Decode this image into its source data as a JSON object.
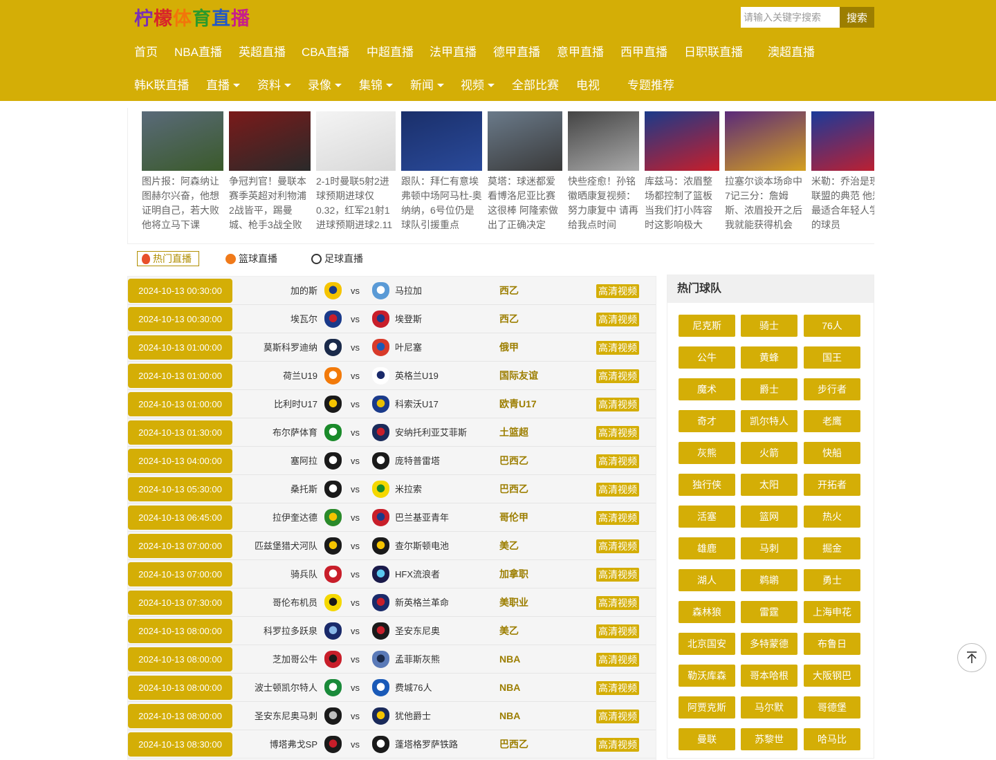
{
  "logo": {
    "chars": [
      "柠",
      "檬",
      "体",
      "育",
      "直",
      "播"
    ]
  },
  "search": {
    "placeholder": "请输入关键字搜索",
    "button": "搜索"
  },
  "nav": {
    "row1": [
      "首页",
      "NBA直播",
      "英超直播",
      "CBA直播",
      "中超直播",
      "法甲直播",
      "德甲直播",
      "意甲直播",
      "西甲直播",
      "日职联直播",
      "澳超直播"
    ],
    "row2": [
      {
        "label": "韩K联直播",
        "dropdown": false
      },
      {
        "label": "直播",
        "dropdown": true
      },
      {
        "label": "资料",
        "dropdown": true
      },
      {
        "label": "录像",
        "dropdown": true
      },
      {
        "label": "集锦",
        "dropdown": true
      },
      {
        "label": "新闻",
        "dropdown": true
      },
      {
        "label": "视频",
        "dropdown": true
      },
      {
        "label": "全部比赛",
        "dropdown": false
      },
      {
        "label": "电视",
        "dropdown": false
      },
      {
        "label": "专题推荐",
        "dropdown": false
      }
    ]
  },
  "carousel": [
    {
      "caption": "图片报：阿森纳让图赫尔兴奋，他想证明自己，若大败他将立马下课",
      "colors": [
        "#5a6a7a",
        "#3a5a2a"
      ]
    },
    {
      "caption": "争冠判官！曼联本赛季英超对利物浦2战皆平，踢曼城、枪手3战全败",
      "colors": [
        "#7a1a1a",
        "#2a2a2a"
      ]
    },
    {
      "caption": "2-1时曼联5射2进球预期进球仅0.32，红军21射1进球预期进球2.11",
      "colors": [
        "#f4f4f4",
        "#d8d8d8"
      ]
    },
    {
      "caption": "跟队：拜仁有意埃弗顿中场阿马杜-奥纳纳，6号位仍是球队引援重点",
      "colors": [
        "#1a2f6a",
        "#2a4a9a"
      ]
    },
    {
      "caption": "莫塔：球迷都爱看博洛尼亚比赛 这很棒 阿隆索做出了正确决定",
      "colors": [
        "#6a7a8a",
        "#3a3a3a"
      ]
    },
    {
      "caption": "快些痊愈！孙铭徽晒康复视频：努力康复中 请再给我点时间",
      "colors": [
        "#444444",
        "#aaaaaa"
      ]
    },
    {
      "caption": "库兹马：浓眉整场都控制了篮板 当我们打小阵容时这影响极大",
      "colors": [
        "#1a3a8a",
        "#c81e2a"
      ]
    },
    {
      "caption": "拉塞尔谈本场命中7记三分：詹姆斯、浓眉投开之后我就能获得机会",
      "colors": [
        "#5a2a7a",
        "#d4a020"
      ]
    },
    {
      "caption": "米勒：乔治是现在联盟的典范 他是最适合年轻人学习的球员",
      "colors": [
        "#1a3a9a",
        "#c81e2a"
      ]
    }
  ],
  "tabs": [
    {
      "label": "热门直播",
      "icon": "flame-icon"
    },
    {
      "label": "篮球直播",
      "icon": "basketball-icon"
    },
    {
      "label": "足球直播",
      "icon": "soccer-ball-icon"
    }
  ],
  "matches": [
    {
      "time": "2024-10-13 00:30:00",
      "home": "加的斯",
      "away": "马拉加",
      "league": "西乙",
      "video": "高清视频",
      "hc": [
        "#f5c400",
        "#1a3a8a"
      ],
      "ac": [
        "#5a9ad6",
        "#ffffff"
      ]
    },
    {
      "time": "2024-10-13 00:30:00",
      "home": "埃瓦尔",
      "away": "埃登斯",
      "league": "西乙",
      "video": "高清视频",
      "hc": [
        "#1a3a8a",
        "#c81e2a"
      ],
      "ac": [
        "#c81e2a",
        "#1a3a8a"
      ]
    },
    {
      "time": "2024-10-13 01:00:00",
      "home": "莫斯科罗迪纳",
      "away": "叶尼塞",
      "league": "俄甲",
      "video": "高清视频",
      "hc": [
        "#1a2a4a",
        "#ffffff"
      ],
      "ac": [
        "#d83a2a",
        "#1a5ab8"
      ]
    },
    {
      "time": "2024-10-13 01:00:00",
      "home": "荷兰U19",
      "away": "英格兰U19",
      "league": "国际友谊",
      "video": "高清视频",
      "hc": [
        "#f27a0a",
        "#ffffff"
      ],
      "ac": [
        "#ffffff",
        "#1a2a6a"
      ]
    },
    {
      "time": "2024-10-13 01:00:00",
      "home": "比利时U17",
      "away": "科索沃U17",
      "league": "欧青U17",
      "video": "高清视频",
      "hc": [
        "#1a1a1a",
        "#f5c400"
      ],
      "ac": [
        "#1a3a8a",
        "#e8c000"
      ]
    },
    {
      "time": "2024-10-13 01:30:00",
      "home": "布尔萨体育",
      "away": "安纳托利亚艾菲斯",
      "league": "土篮超",
      "video": "高清视频",
      "hc": [
        "#1a8a2a",
        "#ffffff"
      ],
      "ac": [
        "#1a2a5a",
        "#c81e2a"
      ]
    },
    {
      "time": "2024-10-13 04:00:00",
      "home": "塞阿拉",
      "away": "庞特普雷塔",
      "league": "巴西乙",
      "video": "高清视频",
      "hc": [
        "#1a1a1a",
        "#ffffff"
      ],
      "ac": [
        "#1a1a1a",
        "#ffffff"
      ]
    },
    {
      "time": "2024-10-13 05:30:00",
      "home": "桑托斯",
      "away": "米拉索",
      "league": "巴西乙",
      "video": "高清视频",
      "hc": [
        "#1a1a1a",
        "#ffffff"
      ],
      "ac": [
        "#f5d800",
        "#1a8a2a"
      ]
    },
    {
      "time": "2024-10-13 06:45:00",
      "home": "拉伊奎达德",
      "away": "巴兰基亚青年",
      "league": "哥伦甲",
      "video": "高清视频",
      "hc": [
        "#2a8a2a",
        "#f5c400"
      ],
      "ac": [
        "#c81e2a",
        "#1a3a8a"
      ]
    },
    {
      "time": "2024-10-13 07:00:00",
      "home": "匹兹堡猎犬河队",
      "away": "查尔斯顿电池",
      "league": "美乙",
      "video": "高清视频",
      "hc": [
        "#1a1a1a",
        "#f5c400"
      ],
      "ac": [
        "#1a1a1a",
        "#f5c400"
      ]
    },
    {
      "time": "2024-10-13 07:00:00",
      "home": "骑兵队",
      "away": "HFX流浪者",
      "league": "加拿职",
      "video": "高清视频",
      "hc": [
        "#c81e2a",
        "#ffffff"
      ],
      "ac": [
        "#1a1a4a",
        "#5ac8f0"
      ]
    },
    {
      "time": "2024-10-13 07:30:00",
      "home": "哥伦布机员",
      "away": "新英格兰革命",
      "league": "美职业",
      "video": "高清视频",
      "hc": [
        "#f5d800",
        "#1a1a1a"
      ],
      "ac": [
        "#1a2a6a",
        "#c81e2a"
      ]
    },
    {
      "time": "2024-10-13 08:00:00",
      "home": "科罗拉多跃泉",
      "away": "圣安东尼奥",
      "league": "美乙",
      "video": "高清视频",
      "hc": [
        "#1a2a6a",
        "#8ab8e8"
      ],
      "ac": [
        "#1a1a1a",
        "#c81e2a"
      ]
    },
    {
      "time": "2024-10-13 08:00:00",
      "home": "芝加哥公牛",
      "away": "孟菲斯灰熊",
      "league": "NBA",
      "video": "高清视频",
      "hc": [
        "#c81e2a",
        "#1a1a1a"
      ],
      "ac": [
        "#5a7ab8",
        "#1a2a4a"
      ]
    },
    {
      "time": "2024-10-13 08:00:00",
      "home": "波士顿凯尔特人",
      "away": "费城76人",
      "league": "NBA",
      "video": "高清视频",
      "hc": [
        "#1a8a3a",
        "#ffffff"
      ],
      "ac": [
        "#1a5ab8",
        "#ffffff"
      ]
    },
    {
      "time": "2024-10-13 08:00:00",
      "home": "圣安东尼奥马刺",
      "away": "犹他爵士",
      "league": "NBA",
      "video": "高清视频",
      "hc": [
        "#1a1a1a",
        "#c0c0c0"
      ],
      "ac": [
        "#1a2a5a",
        "#f5c400"
      ]
    },
    {
      "time": "2024-10-13 08:30:00",
      "home": "博塔弗戈SP",
      "away": "蓬塔格罗萨铁路",
      "league": "巴西乙",
      "video": "高清视频",
      "hc": [
        "#1a1a1a",
        "#c81e2a"
      ],
      "ac": [
        "#1a1a1a",
        "#ffffff"
      ]
    }
  ],
  "sidebar": {
    "title": "热门球队",
    "teams": [
      "尼克斯",
      "骑士",
      "76人",
      "公牛",
      "黄蜂",
      "国王",
      "魔术",
      "爵士",
      "步行者",
      "奇才",
      "凯尔特人",
      "老鹰",
      "灰熊",
      "火箭",
      "快船",
      "独行侠",
      "太阳",
      "开拓者",
      "活塞",
      "篮网",
      "热火",
      "雄鹿",
      "马刺",
      "掘金",
      "湖人",
      "鹈鹕",
      "勇士",
      "森林狼",
      "雷霆",
      "上海申花",
      "北京国安",
      "多特蒙德",
      "布鲁日",
      "勒沃库森",
      "哥本哈根",
      "大阪钢巴",
      "阿贾克斯",
      "马尔默",
      "哥德堡",
      "曼联",
      "苏黎世",
      "哈马比"
    ]
  },
  "colors": {
    "brand": "#d4ae06",
    "brand_dark": "#9c7e00"
  }
}
